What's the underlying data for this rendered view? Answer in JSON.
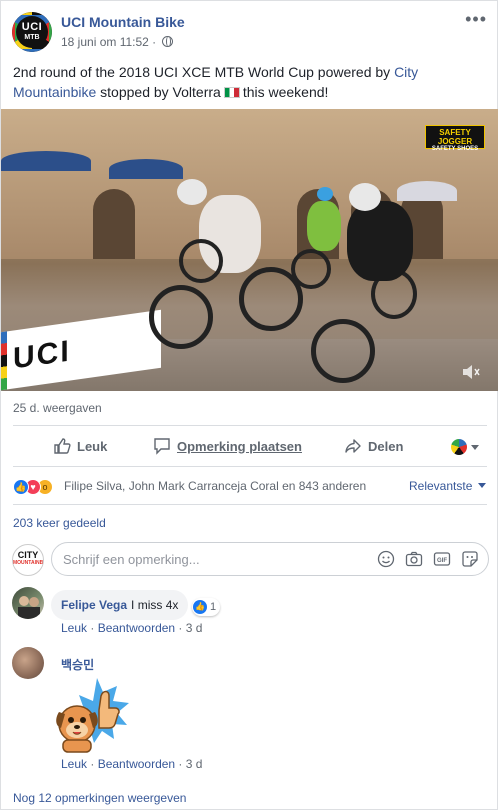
{
  "post": {
    "page_name": "UCI Mountain Bike",
    "timestamp": "18 juni om 11:52 ·",
    "avatar_text_top": "UCI",
    "avatar_text_bottom": "MTB",
    "more_label": "•••",
    "text_before_link": "2nd round of the 2018 UCI XCE MTB World Cup powered by ",
    "link_text_1": "City",
    "link_text_2": "Mountainbike",
    "text_after_link": " stopped by Volterra",
    "text_end": "this weekend!"
  },
  "video": {
    "banner_text": "UCI",
    "sponsor_line1": "SAFETY JOGGER",
    "sponsor_line2": "SAFETY SHOES",
    "views": "25 d. weergaven"
  },
  "actions": {
    "like": "Leuk",
    "comment": "Opmerking plaatsen",
    "share": "Delen"
  },
  "reactions": {
    "names": "Filipe Silva, John Mark Carranceja Coral en 843 anderen",
    "sort_label": "Relevantste",
    "shares": "203 keer gedeeld"
  },
  "comment_input": {
    "placeholder": "Schrijf een opmerking...",
    "avatar_top": "CITY",
    "avatar_bottom": "MOUNTAINBIKE",
    "gif_label": "GIF"
  },
  "comments": [
    {
      "author": "Felipe Vega",
      "text": "I miss 4x",
      "like_count": "1",
      "like_action": "Leuk",
      "reply_action": "Beantwoorden",
      "age": "3 d"
    },
    {
      "author": "백승민",
      "like_action": "Leuk",
      "reply_action": "Beantwoorden",
      "age": "3 d"
    }
  ],
  "footer": {
    "more_comments": "Nog 12 opmerkingen weergeven"
  },
  "colors": {
    "link": "#385898",
    "meta": "#606770",
    "facebook_blue": "#1877f2"
  }
}
